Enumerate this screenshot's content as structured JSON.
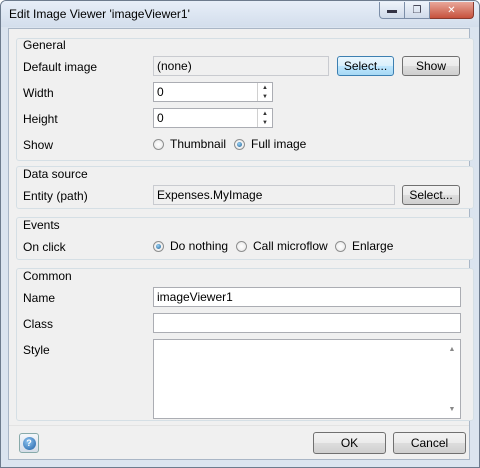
{
  "window": {
    "title": "Edit Image Viewer 'imageViewer1'",
    "min_glyph": "▬",
    "max_glyph": "❐",
    "close_glyph": "✕"
  },
  "general": {
    "title": "General",
    "default_image_label": "Default image",
    "default_image_value": "(none)",
    "select_label": "Select...",
    "show_label": "Show",
    "width_label": "Width",
    "width_value": "0",
    "height_label": "Height",
    "height_value": "0",
    "show_mode_label": "Show",
    "show_options": [
      "Thumbnail",
      "Full image"
    ],
    "show_selected": "Full image"
  },
  "data_source": {
    "title": "Data source",
    "entity_label": "Entity (path)",
    "entity_value": "Expenses.MyImage",
    "select_label": "Select..."
  },
  "events": {
    "title": "Events",
    "on_click_label": "On click",
    "options": [
      "Do nothing",
      "Call microflow",
      "Enlarge"
    ],
    "selected": "Do nothing"
  },
  "common": {
    "title": "Common",
    "name_label": "Name",
    "name_value": "imageViewer1",
    "class_label": "Class",
    "class_value": "",
    "style_label": "Style",
    "style_value": ""
  },
  "footer": {
    "help_glyph": "?",
    "ok_label": "OK",
    "cancel_label": "Cancel"
  }
}
